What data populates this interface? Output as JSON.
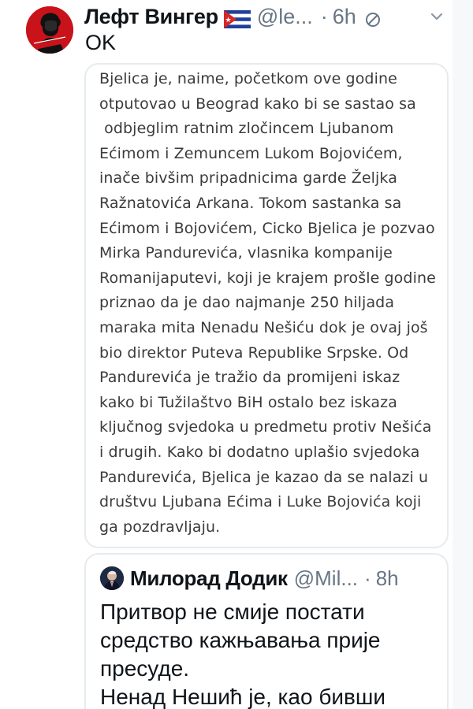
{
  "tweet": {
    "display_name": "Лефт Вингер",
    "flag_icon": "cuba-flag-icon",
    "handle": "@le...",
    "separator": "·",
    "time": "6h",
    "edit_icon": "edited-icon",
    "more_icon": "chevron-down-icon",
    "text": "OK",
    "avatar_icon": "profile-avatar",
    "colors": {
      "name": "#0f1419",
      "secondary": "#687684",
      "border": "#e6ebee",
      "avatar_bg": "#c8131b",
      "flag_blue": "#1f3f9a",
      "flag_red": "#d62828"
    }
  },
  "image_card": {
    "lines": [
      "Bjelica je, naime, početkom ove godine",
      "otputovao u Beograd kako bi se sastao sa",
      " odbjeglim ratnim zločincem Ljubanom",
      "Ećimom i Zemuncem Lukom Bojovićem,",
      "inače bivšim pripadnicima garde Željka",
      "Ražnatovića Arkana. Tokom sastanka sa",
      "Ećimom i Bojovićem, Cicko Bjelica je pozvao",
      "Mirka Pandurevića, vlasnika kompanije",
      "Romanijaputevi, koji je krajem prošle godine",
      "priznao da je dao najmanje 250 hiljada",
      "maraka mita Nenadu Nešiću dok je ovaj još",
      "bio direktor Puteva Republike Srpske. Od",
      "Pandurevića je tražio da promijeni iskaz",
      "kako bi Tužilaštvo BiH ostalo bez iskaza",
      "ključnog svjedoka u predmetu protiv Nešića",
      "i drugih. Kako bi dodatno uplašio svjedoka",
      "Pandurevića, Bjelica je kazao da se nalazi u",
      "društvu Ljubana Ećima i Luke Bojovića koji",
      "ga pozdravljaju."
    ]
  },
  "quote": {
    "avatar_icon": "quoted-user-avatar",
    "display_name": "Милорад Додик",
    "handle": "@Mil...",
    "separator": "·",
    "time": "8h",
    "lines": [
      "Притвор не смије постати",
      "средство кажњавања прије",
      "пресуде.",
      "Ненад Нешић је, као бивши"
    ]
  }
}
